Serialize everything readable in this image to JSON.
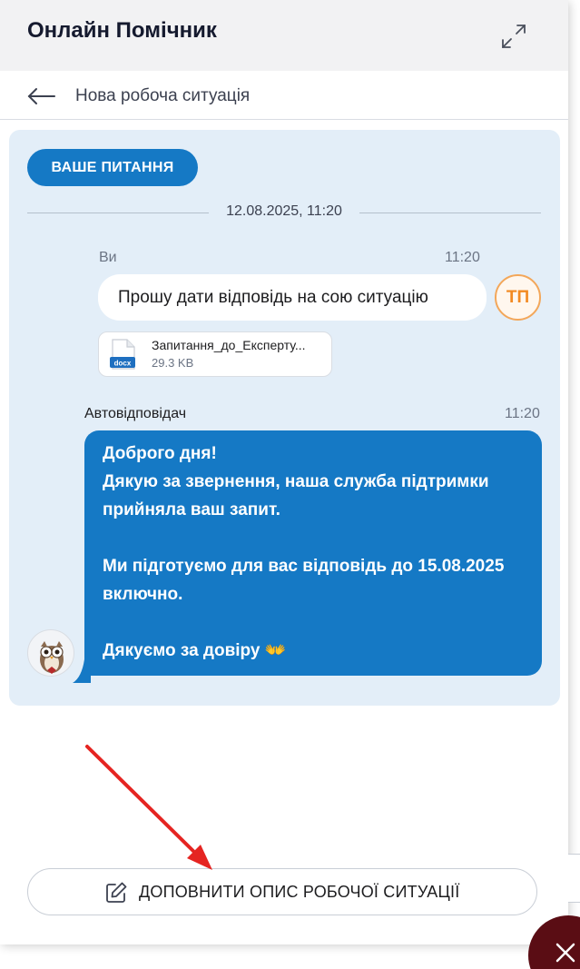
{
  "header": {
    "title": "Онлайн Помічник"
  },
  "subheader": {
    "title": "Нова робоча ситуація"
  },
  "chat": {
    "badge": "ВАШЕ ПИТАННЯ",
    "date": "12.08.2025, 11:20",
    "user_message": {
      "sender": "Ви",
      "time": "11:20",
      "text": "Прошу дати відповідь на сою ситуацію",
      "avatar_initials": "ТП",
      "attachment": {
        "file_name": "Запитання_до_Експерту...",
        "file_size": "29.3 KB",
        "file_type": "docx"
      }
    },
    "bot_message": {
      "sender": "Автовідповідач",
      "time": "11:20",
      "lines": [
        "Доброго дня!",
        "Дякую за звернення, наша служба підтримки",
        "прийняла ваш запит.",
        "",
        "Ми підготуємо для вас відповідь до 15.08.2025",
        "включно.",
        "",
        "Дякуємо за довіру 👐"
      ]
    }
  },
  "footer": {
    "supplement_button": "ДОПОВНИТИ ОПИС РОБОЧОЇ СИТУАЦІЇ"
  },
  "icons": {
    "expand": "expand-icon",
    "back": "arrow-left-icon",
    "edit": "edit-icon",
    "close": "close-icon",
    "docx": "docx-file-icon",
    "bot_avatar": "owl-avatar-icon"
  },
  "colors": {
    "accent": "#1579c5",
    "chat_bg": "#e3eef8",
    "header_bg": "#f2f2f3",
    "avatar_orange": "#f28a22",
    "annotation_arrow": "#e52421",
    "close_fab": "#5a0d14"
  }
}
